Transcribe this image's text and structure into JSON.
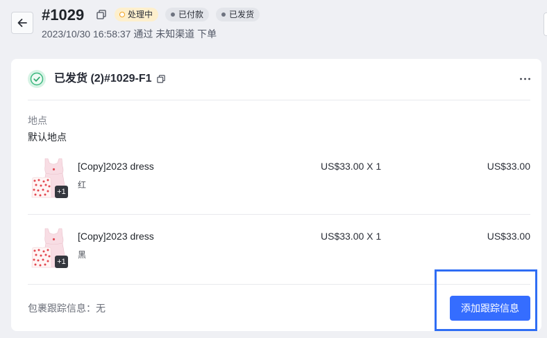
{
  "header": {
    "order_number": "#1029",
    "badges": [
      "处理中",
      "已付款",
      "已发货"
    ],
    "subtitle": "2023/10/30 16:58:37 通过 未知渠道 下单"
  },
  "fulfillment": {
    "title": "已发货 (2)#1029-F1",
    "location": {
      "label": "地点",
      "value": "默认地点"
    },
    "items": [
      {
        "name": "[Copy]2023 dress",
        "variant": "红",
        "price_quantity": "US$33.00 X 1",
        "total": "US$33.00",
        "more_images": "+1"
      },
      {
        "name": "[Copy]2023 dress",
        "variant": "黑",
        "price_quantity": "US$33.00 X 1",
        "total": "US$33.00",
        "more_images": "+1"
      }
    ],
    "tracking_info": "包裹跟踪信息：无",
    "add_tracking_button": "添加跟踪信息"
  },
  "icons": {
    "back": "arrow-left-icon",
    "copy_order_number": "copy-icon",
    "badge_processing": "hollow-circle-icon",
    "badge_neutral": "dot-icon",
    "status": "check-circle-icon",
    "copy_fulfillment_id": "copy-icon",
    "more_actions": "more-horizontal-icon"
  },
  "colors": {
    "page_background": "#eff0f4",
    "card_background": "#ffffff",
    "primary_button": "#356dff",
    "success_green": "#3cb97f",
    "processing_orange": "#f2a321",
    "processing_badge_background": "#fdefcd",
    "neutral_badge_background": "#e3e5ea",
    "highlight_outline": "#2f6df4"
  }
}
